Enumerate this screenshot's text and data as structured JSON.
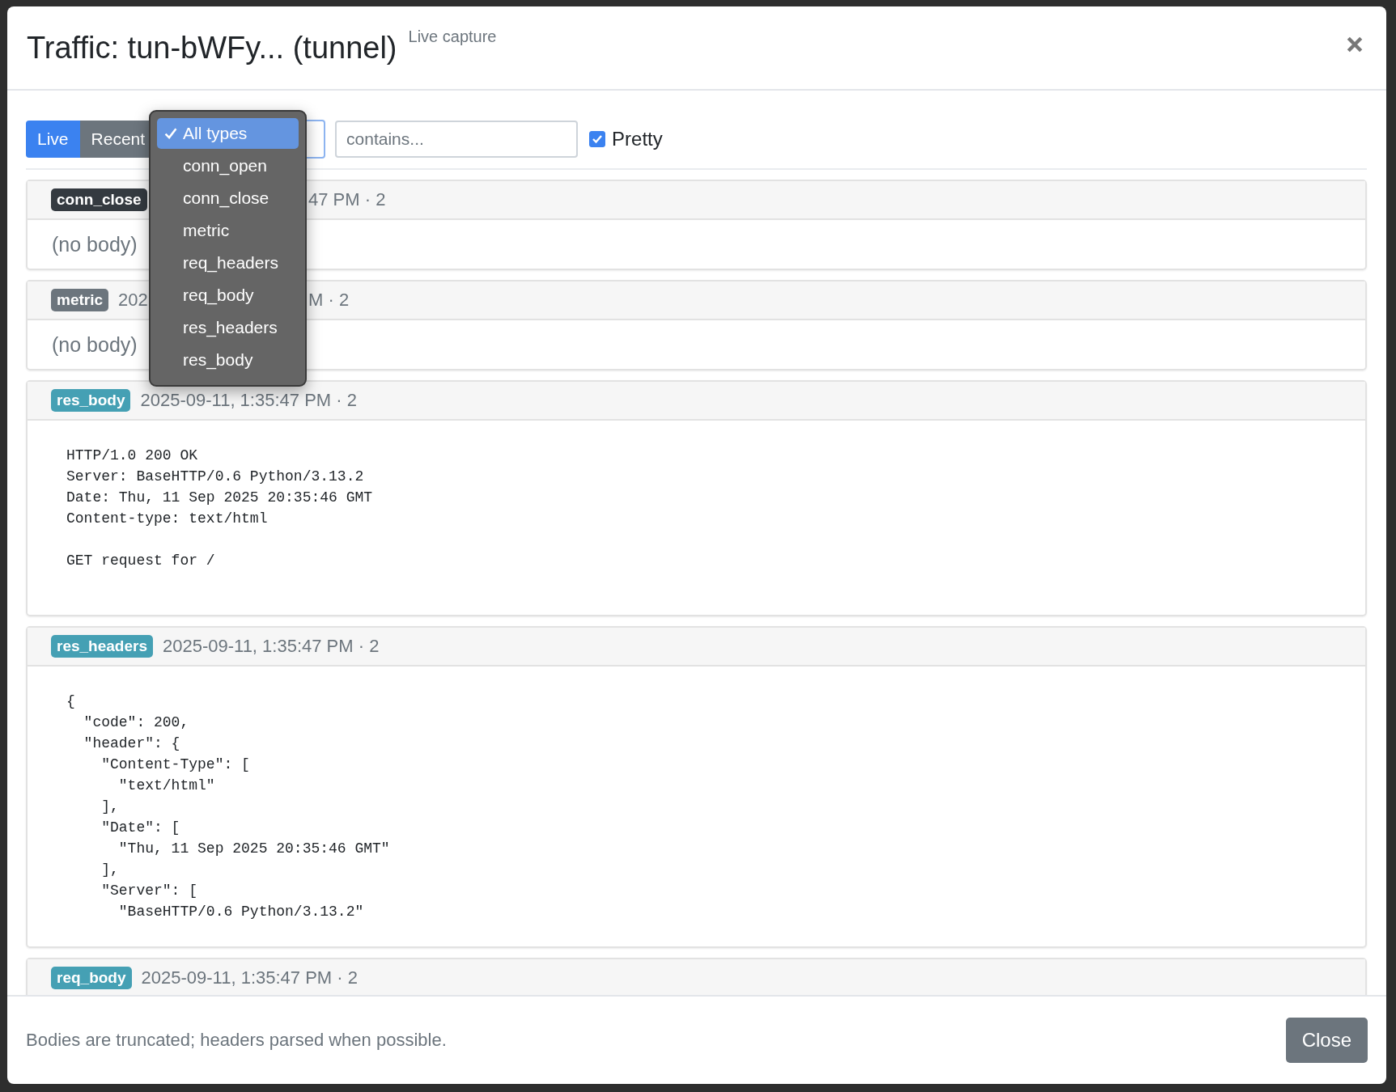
{
  "dialog": {
    "title": "Traffic: tun-bWFy... (tunnel)",
    "subtitle": "Live capture"
  },
  "toolbar": {
    "modes": [
      {
        "label": "Live",
        "selected": true
      },
      {
        "label": "Recent",
        "selected": false
      }
    ],
    "type_menu": {
      "items": [
        {
          "label": "All types",
          "selected": true
        },
        {
          "label": "conn_open",
          "selected": false
        },
        {
          "label": "conn_close",
          "selected": false
        },
        {
          "label": "metric",
          "selected": false
        },
        {
          "label": "req_headers",
          "selected": false
        },
        {
          "label": "req_body",
          "selected": false
        },
        {
          "label": "res_headers",
          "selected": false
        },
        {
          "label": "res_body",
          "selected": false
        }
      ]
    },
    "search": {
      "placeholder": "contains..."
    },
    "pretty": {
      "label": "Pretty",
      "checked": true
    }
  },
  "events": [
    {
      "type": "conn_close",
      "color": "#343a40",
      "time_after": "47 PM · 2",
      "body": "(no body)",
      "kind": "empty"
    },
    {
      "type": "metric",
      "color": "#6c757d",
      "time_before": "202",
      "time_after": "M · 2",
      "body": "(no body)",
      "kind": "empty"
    },
    {
      "type": "res_body",
      "color": "#45a0b4",
      "time": "2025-09-11, 1:35:47 PM · 2",
      "body": "HTTP/1.0 200 OK\nServer: BaseHTTP/0.6 Python/3.13.2\nDate: Thu, 11 Sep 2025 20:35:46 GMT\nContent-type: text/html\n\nGET request for /",
      "kind": "code"
    },
    {
      "type": "res_headers",
      "color": "#45a0b4",
      "time": "2025-09-11, 1:35:47 PM · 2",
      "body": "{\n  \"code\": 200,\n  \"header\": {\n    \"Content-Type\": [\n      \"text/html\"\n    ],\n    \"Date\": [\n      \"Thu, 11 Sep 2025 20:35:46 GMT\"\n    ],\n    \"Server\": [\n      \"BaseHTTP/0.6 Python/3.13.2\"",
      "kind": "code"
    },
    {
      "type": "req_body",
      "color": "#45a0b4",
      "time": "2025-09-11, 1:35:47 PM · 2",
      "kind": "collapsed"
    }
  ],
  "footer": {
    "note": "Bodies are truncated; headers parsed when possible.",
    "close_button": "Close"
  }
}
